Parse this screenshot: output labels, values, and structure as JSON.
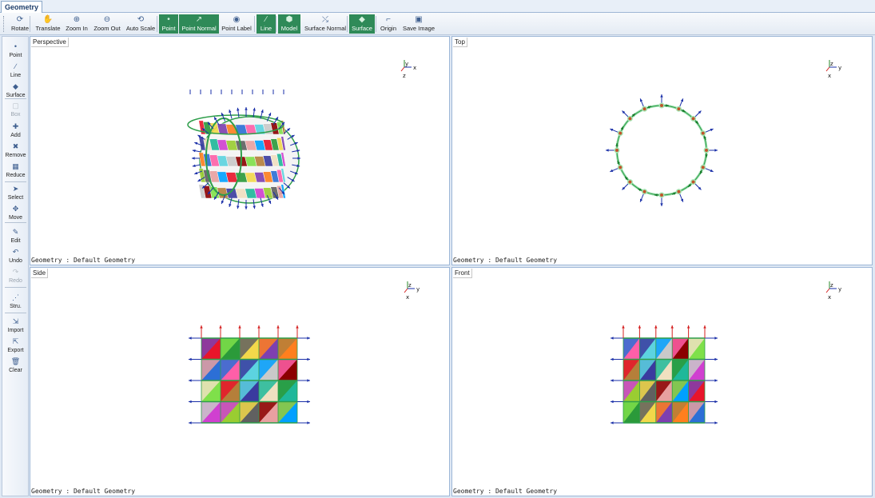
{
  "window": {
    "tab_label": "Geometry"
  },
  "toolbar": [
    {
      "label": "Rotate",
      "icon": "rotate-icon",
      "active": false
    },
    {
      "label": "Translate",
      "icon": "hand-icon",
      "active": false
    },
    {
      "label": "Zoom In",
      "icon": "zoom-in-icon",
      "active": false
    },
    {
      "label": "Zoom Out",
      "icon": "zoom-out-icon",
      "active": false
    },
    {
      "label": "Auto Scale",
      "icon": "auto-scale-icon",
      "active": false
    },
    {
      "label": "Point",
      "icon": "point-icon",
      "active": true
    },
    {
      "label": "Point Normal",
      "icon": "point-normal-icon",
      "active": true
    },
    {
      "label": "Point Label",
      "icon": "point-label-icon",
      "active": false
    },
    {
      "label": "Line",
      "icon": "line-icon",
      "active": true
    },
    {
      "label": "Model",
      "icon": "model-icon",
      "active": true
    },
    {
      "label": "Surface Normal",
      "icon": "surface-normal-icon",
      "active": false
    },
    {
      "label": "Surface",
      "icon": "surface-icon",
      "active": true
    },
    {
      "label": "Origin",
      "icon": "origin-icon",
      "active": false
    },
    {
      "label": "Save Image",
      "icon": "save-image-icon",
      "active": false
    }
  ],
  "sidebar": [
    {
      "label": "Point",
      "icon": "point-icon",
      "enabled": true
    },
    {
      "label": "Line",
      "icon": "line-icon",
      "enabled": true
    },
    {
      "label": "Surface",
      "icon": "surface-icon",
      "enabled": true
    },
    {
      "label": "Box",
      "icon": "box-icon",
      "enabled": false
    },
    {
      "label": "Add",
      "icon": "add-icon",
      "enabled": true
    },
    {
      "label": "Remove",
      "icon": "remove-icon",
      "enabled": true
    },
    {
      "label": "Reduce",
      "icon": "reduce-icon",
      "enabled": true
    },
    {
      "label": "Select",
      "icon": "select-cursor-icon",
      "enabled": true
    },
    {
      "label": "Move",
      "icon": "move-icon",
      "enabled": true
    },
    {
      "label": "Edit",
      "icon": "edit-icon",
      "enabled": true
    },
    {
      "label": "Undo",
      "icon": "undo-icon",
      "enabled": true
    },
    {
      "label": "Redo",
      "icon": "redo-icon",
      "enabled": false
    },
    {
      "label": "Stru.",
      "icon": "structure-icon",
      "enabled": true
    },
    {
      "label": "Import",
      "icon": "import-icon",
      "enabled": true
    },
    {
      "label": "Export",
      "icon": "export-icon",
      "enabled": true
    },
    {
      "label": "Clear",
      "icon": "trash-icon",
      "enabled": true
    }
  ],
  "viewports": [
    {
      "title": "Perspective",
      "footer": "Geometry : Default Geometry",
      "axes": [
        "y",
        "x",
        "z"
      ]
    },
    {
      "title": "Top",
      "footer": "Geometry : Default Geometry",
      "axes": [
        "z",
        "y",
        "x"
      ]
    },
    {
      "title": "Side",
      "footer": "Geometry : Default Geometry",
      "axes": [
        "z",
        "y",
        "x"
      ]
    },
    {
      "title": "Front",
      "footer": "Geometry : Default Geometry",
      "axes": [
        "z",
        "y",
        "x"
      ]
    }
  ],
  "colors": {
    "active_button": "#2f8a58",
    "normal_arrow": "#1a2fa8",
    "up_arrow": "#d42020",
    "edge_line": "#2e9e4a",
    "point": "#c0542a"
  }
}
